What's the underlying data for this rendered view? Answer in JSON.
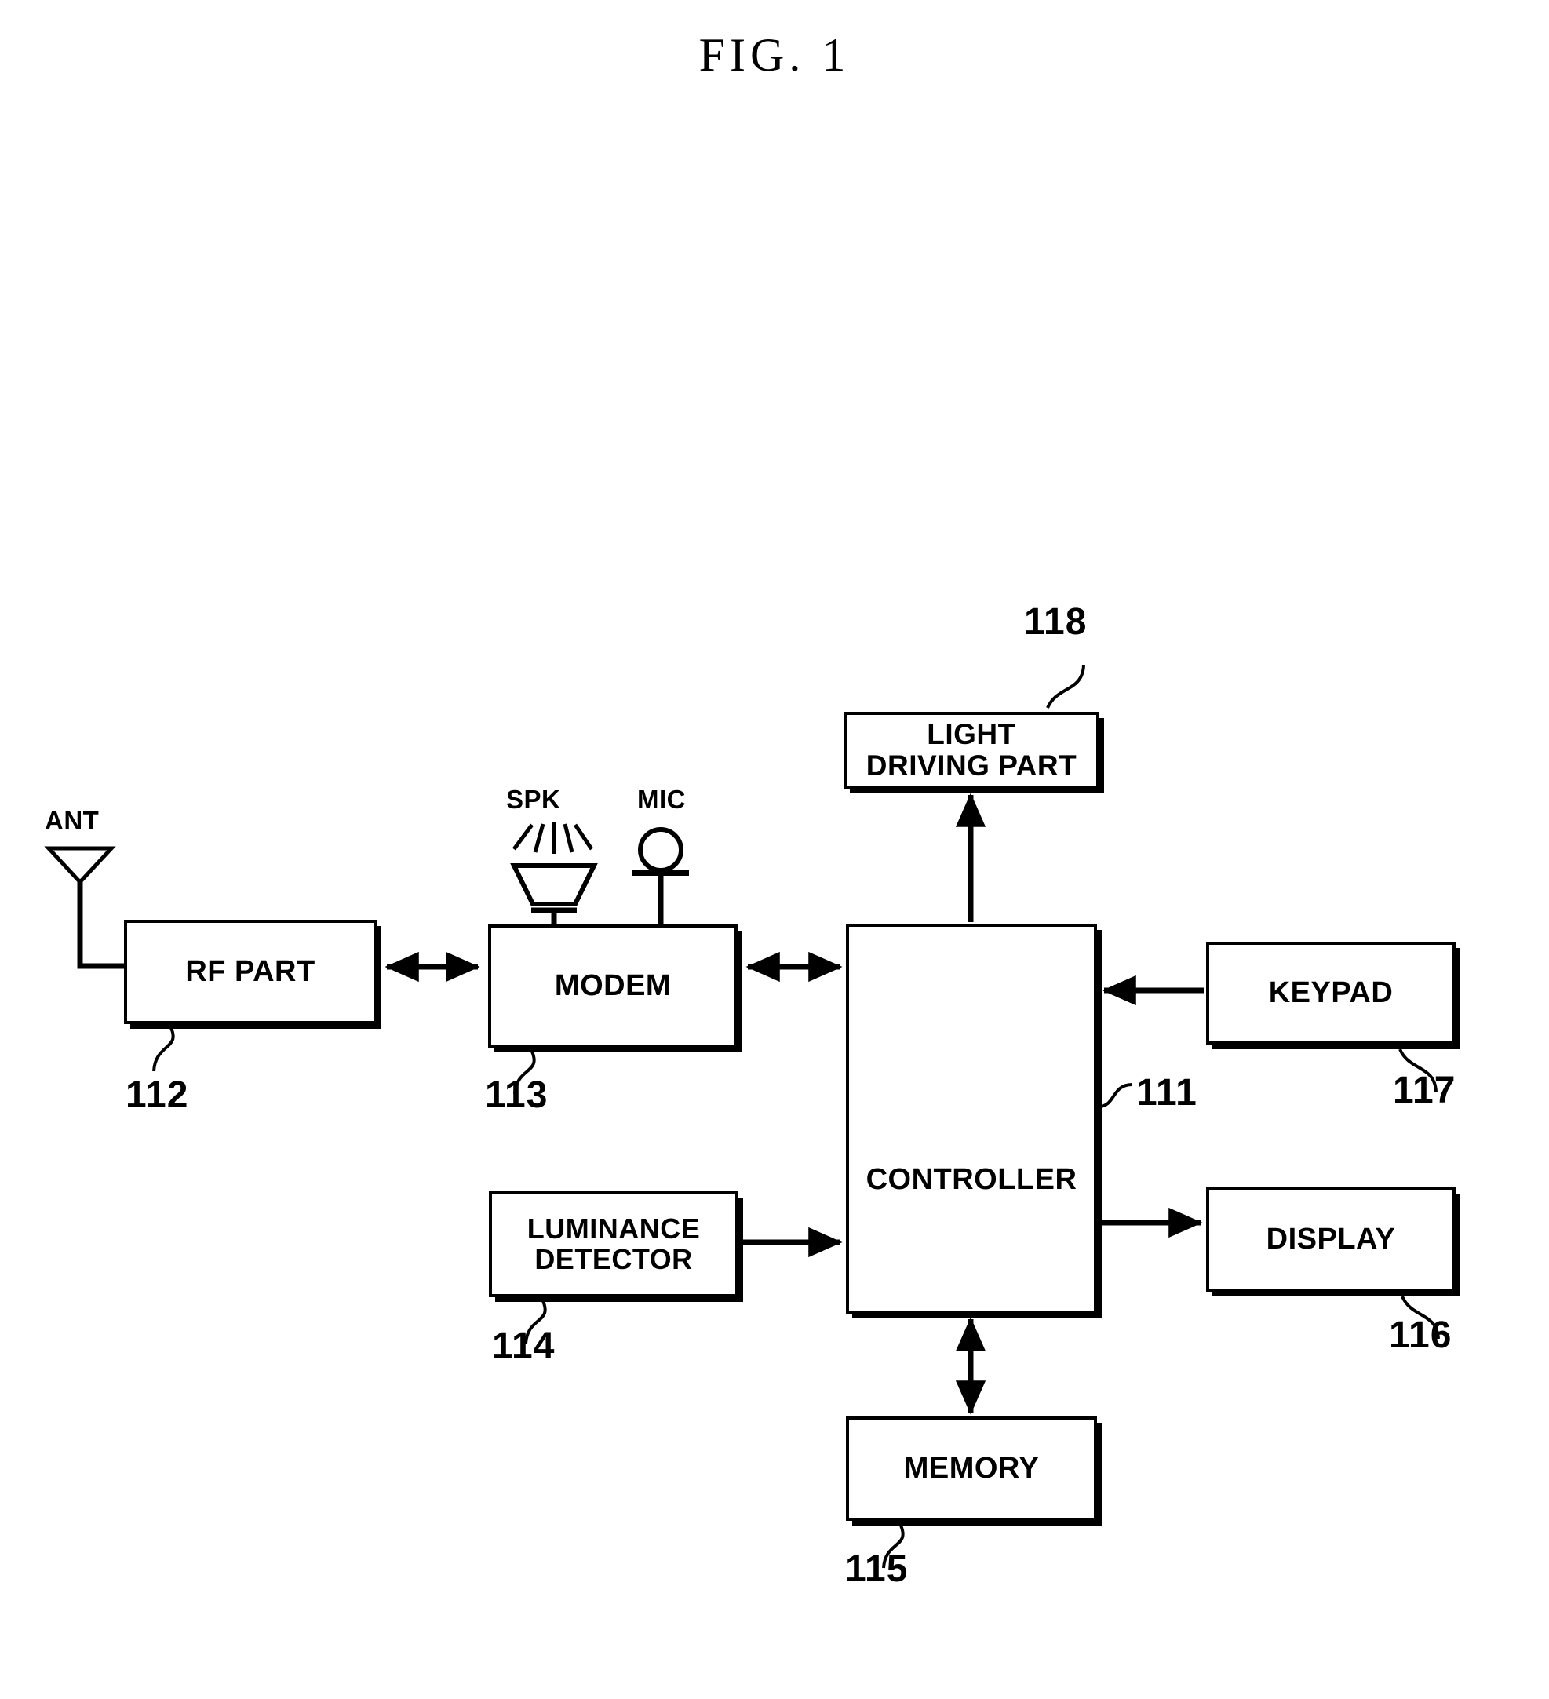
{
  "figure": {
    "title": "FIG. 1",
    "type": "patent-block-diagram",
    "description": "Block diagram of a mobile terminal with a luminance detector and light driving part controlled by a controller."
  },
  "blocks": [
    {
      "id": "light_driving_part",
      "label": "LIGHT\nDRIVING PART",
      "ref": "118"
    },
    {
      "id": "rf_part",
      "label": "RF PART",
      "ref": "112"
    },
    {
      "id": "modem",
      "label": "MODEM",
      "ref": "113"
    },
    {
      "id": "controller",
      "label": "CONTROLLER",
      "ref": "111"
    },
    {
      "id": "keypad",
      "label": "KEYPAD",
      "ref": "117"
    },
    {
      "id": "luminance_detector",
      "label": "LUMINANCE\nDETECTOR",
      "ref": "114"
    },
    {
      "id": "display",
      "label": "DISPLAY",
      "ref": "116"
    },
    {
      "id": "memory",
      "label": "MEMORY",
      "ref": "115"
    }
  ],
  "components": {
    "antenna": {
      "label": "ANT",
      "symbol": "antenna-triangle"
    },
    "speaker": {
      "label": "SPK",
      "symbol": "speaker-cone"
    },
    "microphone": {
      "label": "MIC",
      "symbol": "microphone-circle"
    }
  },
  "refs": {
    "controller": "111",
    "rf_part": "112",
    "modem": "113",
    "luminance_detector": "114",
    "memory": "115",
    "display": "116",
    "keypad": "117",
    "light_driving_part": "118"
  },
  "connections": [
    {
      "from": "antenna",
      "to": "rf_part",
      "arrow": "none"
    },
    {
      "from": "rf_part",
      "to": "modem",
      "arrow": "both"
    },
    {
      "from": "speaker",
      "to": "modem",
      "arrow": "none"
    },
    {
      "from": "microphone",
      "to": "modem",
      "arrow": "none"
    },
    {
      "from": "modem",
      "to": "controller",
      "arrow": "both"
    },
    {
      "from": "controller",
      "to": "light_driving_part",
      "arrow": "up"
    },
    {
      "from": "keypad",
      "to": "controller",
      "arrow": "left"
    },
    {
      "from": "luminance_detector",
      "to": "controller",
      "arrow": "right"
    },
    {
      "from": "controller",
      "to": "display",
      "arrow": "right"
    },
    {
      "from": "controller",
      "to": "memory",
      "arrow": "both"
    }
  ],
  "colors": {
    "ink": "#000000",
    "paper": "#ffffff"
  }
}
